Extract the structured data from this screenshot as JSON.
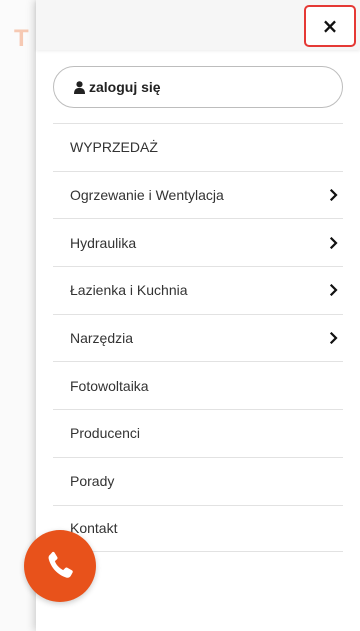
{
  "background": {
    "logo_glyph": "T"
  },
  "drawer": {
    "close_label": "×",
    "login_label": "zaloguj się",
    "menu": [
      {
        "label": "WYPRZEDAŻ",
        "has_submenu": false
      },
      {
        "label": "Ogrzewanie i Wentylacja",
        "has_submenu": true
      },
      {
        "label": "Hydraulika",
        "has_submenu": true
      },
      {
        "label": "Łazienka i Kuchnia",
        "has_submenu": true
      },
      {
        "label": "Narzędzia",
        "has_submenu": true
      },
      {
        "label": "Fotowoltaika",
        "has_submenu": false
      },
      {
        "label": "Producenci",
        "has_submenu": false
      },
      {
        "label": "Porady",
        "has_submenu": false
      },
      {
        "label": "Kontakt",
        "has_submenu": false
      }
    ]
  },
  "colors": {
    "accent": "#e8521b",
    "close_border": "#e53935"
  },
  "icons": {
    "close": "close-icon",
    "user": "user-icon",
    "chevron": "chevron-right-icon",
    "phone": "phone-icon"
  }
}
